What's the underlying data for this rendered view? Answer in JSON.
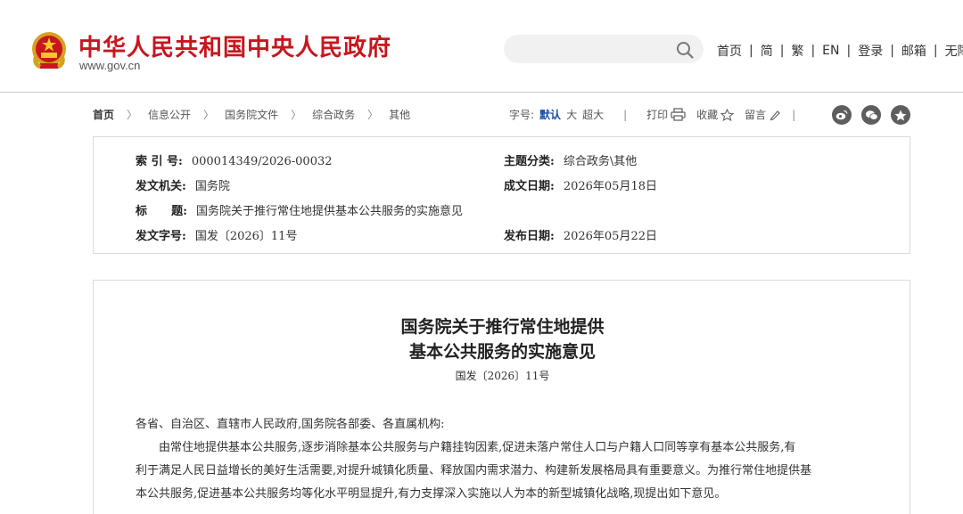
{
  "header": {
    "site_title": "中华人民共和国中央人民政府",
    "site_domain": "www.gov.cn",
    "search_placeholder": "",
    "nav": [
      "首页",
      "简",
      "繁",
      "EN",
      "登录",
      "邮箱",
      "无障碍"
    ]
  },
  "breadcrumb": [
    "首页",
    "信息公开",
    "国务院文件",
    "综合政务",
    "其他"
  ],
  "tools": {
    "font_label": "字号:",
    "font_options": [
      "默认",
      "大",
      "超大"
    ],
    "font_active": "默认",
    "print": "打印",
    "favorite": "收藏",
    "comment": "留言"
  },
  "share_icons": [
    "weibo-icon",
    "wechat-icon",
    "favorite-star-icon"
  ],
  "info": {
    "index_label": "索 引 号:",
    "index_value": "000014349/2026-00032",
    "topic_label": "主题分类:",
    "topic_value": "综合政务\\其他",
    "issuer_label": "发文机关:",
    "issuer_value": "国务院",
    "created_label": "成文日期:",
    "created_value": "2026年05月18日",
    "title_label": "标      题:",
    "title_value": "国务院关于推行常住地提供基本公共服务的实施意见",
    "docno_label": "发文字号:",
    "docno_value": "国发〔2026〕11号",
    "published_label": "发布日期:",
    "published_value": "2026年05月22日"
  },
  "document": {
    "title_line1": "国务院关于推行常住地提供",
    "title_line2": "基本公共服务的实施意见",
    "doc_number": "国发〔2026〕11号",
    "salutation": "各省、自治区、直辖市人民政府,国务院各部委、各直属机构:",
    "para1_line1": "由常住地提供基本公共服务,逐步消除基本公共服务与户籍挂钩因素,促进未落户常住人口与户籍人口同等享有基本公共服务,有",
    "para1_line2": "利于满足人民日益增长的美好生活需要,对提升城镇化质量、释放国内需求潜力、构建新发展格局具有重要意义。为推行常住地提供基",
    "para1_line3": "本公共服务,促进基本公共服务均等化水平明显提升,有力支撑深入实施以人为本的新型城镇化战略,现提出如下意见。"
  },
  "colors": {
    "brand_red": "#c8161e",
    "accent_blue": "#1a4fa3"
  }
}
